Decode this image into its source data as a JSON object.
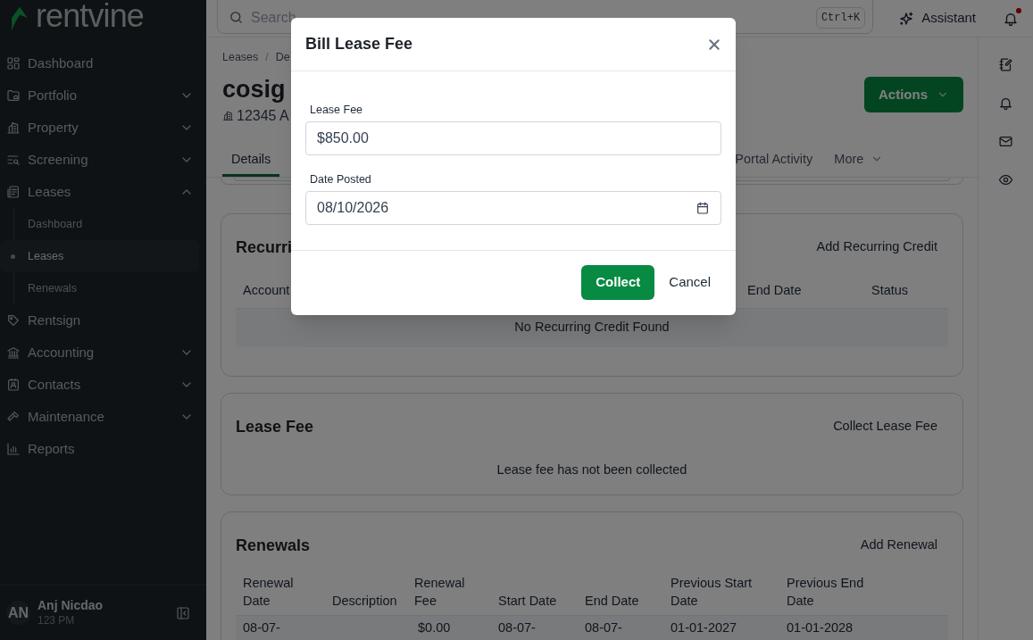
{
  "brand": {
    "name": "rentvine"
  },
  "sidebar": {
    "items": [
      {
        "label": "Dashboard"
      },
      {
        "label": "Portfolio",
        "expanded": false
      },
      {
        "label": "Property",
        "expanded": false
      },
      {
        "label": "Screening",
        "expanded": false
      },
      {
        "label": "Leases",
        "expanded": true,
        "children": [
          {
            "label": "Dashboard",
            "selected": false
          },
          {
            "label": "Leases",
            "selected": true
          },
          {
            "label": "Renewals",
            "selected": false
          }
        ]
      },
      {
        "label": "Rentsign"
      },
      {
        "label": "Accounting",
        "expanded": false
      },
      {
        "label": "Contacts",
        "expanded": false
      },
      {
        "label": "Maintenance",
        "expanded": false
      },
      {
        "label": "Reports"
      }
    ],
    "user": {
      "initials": "AN",
      "name": "Anj Nicdao",
      "subtitle": "123 PM"
    }
  },
  "topbar": {
    "search": {
      "placeholder": "Search",
      "shortcut": "Ctrl+K"
    },
    "assistant": "Assistant",
    "notifications_unread": true
  },
  "header": {
    "breadcrumb": [
      "Leases",
      "De"
    ],
    "breadcrumb_separator": "/",
    "title": "cosig",
    "address": "12345 A",
    "actions": "Actions"
  },
  "tabs": [
    {
      "label": "Details",
      "selected": true
    },
    {
      "label": "Portal Activity",
      "selected": false
    },
    {
      "label": "More",
      "selected": false,
      "kind": "menu"
    }
  ],
  "recurring": {
    "title": "Recurri",
    "action": "Add Recurring Credit",
    "columns": [
      "Account",
      "End Date",
      "Status"
    ],
    "empty": "No Recurring Credit Found"
  },
  "lease_fee": {
    "title": "Lease Fee",
    "action": "Collect Lease Fee",
    "message": "Lease fee has not been collected"
  },
  "renewals": {
    "title": "Renewals",
    "action": "Add Renewal",
    "columns": [
      "Renewal Date",
      "Description",
      "Renewal Fee",
      "Start Date",
      "End Date",
      "Previous Start Date",
      "Previous End Date"
    ],
    "rows": [
      [
        "08-07-",
        "",
        "$0.00",
        "08-07-",
        "08-07-",
        "01-01-2027",
        "01-01-2028"
      ]
    ]
  },
  "modal": {
    "title": "Bill Lease Fee",
    "fields": [
      {
        "label": "Lease Fee",
        "value": "$850.00",
        "kind": "text"
      },
      {
        "label": "Date Posted",
        "value": "08/10/2026",
        "kind": "date"
      }
    ],
    "primary": "Collect",
    "secondary": "Cancel"
  }
}
